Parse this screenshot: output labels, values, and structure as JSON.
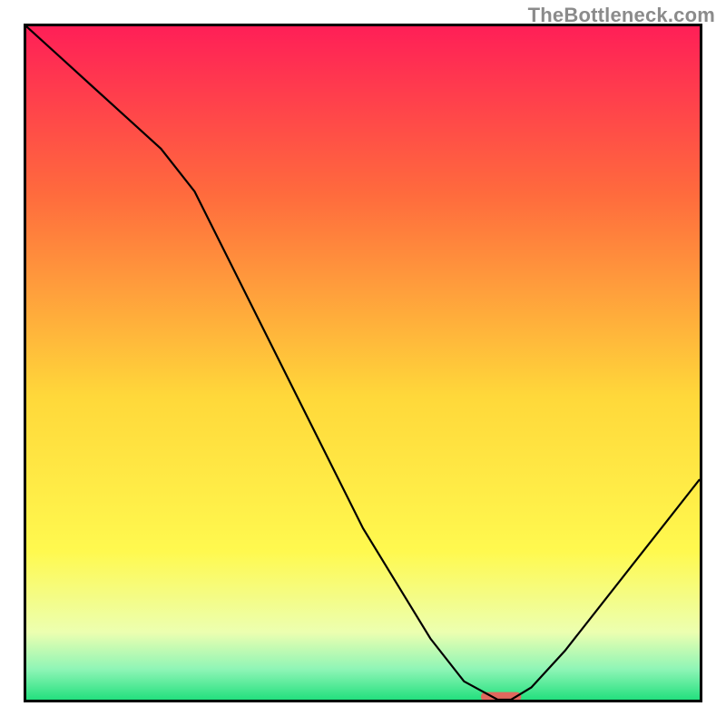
{
  "watermark": "TheBottleneck.com",
  "chart_data": {
    "type": "line",
    "title": "",
    "xlabel": "",
    "ylabel": "",
    "x": [
      0,
      5,
      10,
      15,
      20,
      25,
      30,
      35,
      40,
      45,
      50,
      55,
      60,
      65,
      70,
      72,
      75,
      80,
      85,
      90,
      95,
      100
    ],
    "values": [
      110,
      105,
      100,
      95,
      90,
      83,
      72,
      61,
      50,
      39,
      28,
      19,
      10,
      3,
      0,
      0,
      2,
      8,
      15,
      22,
      29,
      36
    ],
    "ylim": [
      0,
      110
    ],
    "xlim": [
      0,
      100
    ],
    "background_gradient_stops": [
      {
        "offset": 0.0,
        "color": "#ff1f57"
      },
      {
        "offset": 0.25,
        "color": "#ff6b3d"
      },
      {
        "offset": 0.55,
        "color": "#ffd83a"
      },
      {
        "offset": 0.78,
        "color": "#fff94f"
      },
      {
        "offset": 0.9,
        "color": "#ecffb0"
      },
      {
        "offset": 0.955,
        "color": "#8ef5b6"
      },
      {
        "offset": 1.0,
        "color": "#23e07e"
      }
    ],
    "marker": {
      "x": 70.5,
      "y": 0.5,
      "width": 6,
      "height": 1.5,
      "color": "#e0685e"
    }
  }
}
